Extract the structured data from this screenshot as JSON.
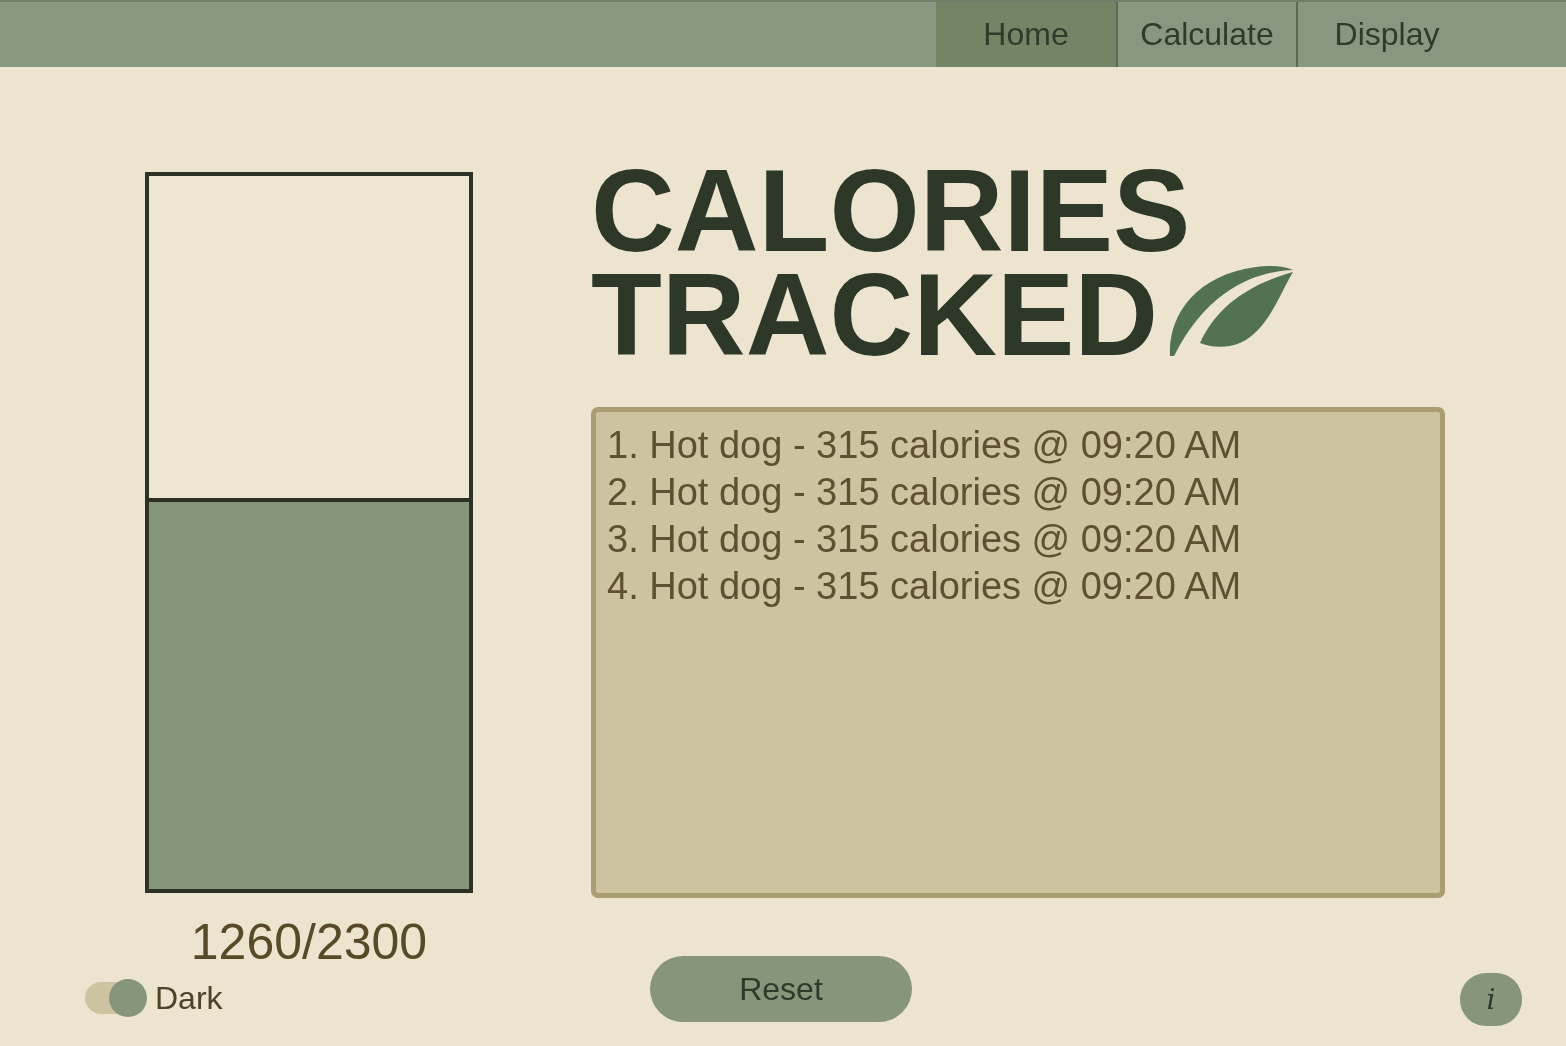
{
  "nav": {
    "tabs": [
      {
        "label": "Home",
        "selected": true
      },
      {
        "label": "Calculate",
        "selected": false
      },
      {
        "label": "Display",
        "selected": false
      }
    ]
  },
  "meter": {
    "level": 0.548,
    "reading": "1260/2300"
  },
  "dark_mode": {
    "label": "Dark",
    "on": true
  },
  "title_lines": [
    "CALORIES",
    "TRACKED"
  ],
  "log": {
    "entries": [
      "1. Hot dog - 315 calories @ 09:20 AM",
      "2. Hot dog - 315 calories @ 09:20 AM",
      "3. Hot dog - 315 calories @ 09:20 AM",
      "4. Hot dog - 315 calories @ 09:20 AM"
    ]
  },
  "reset_button": {
    "label": "Reset"
  },
  "info_button": {
    "label": "i"
  }
}
